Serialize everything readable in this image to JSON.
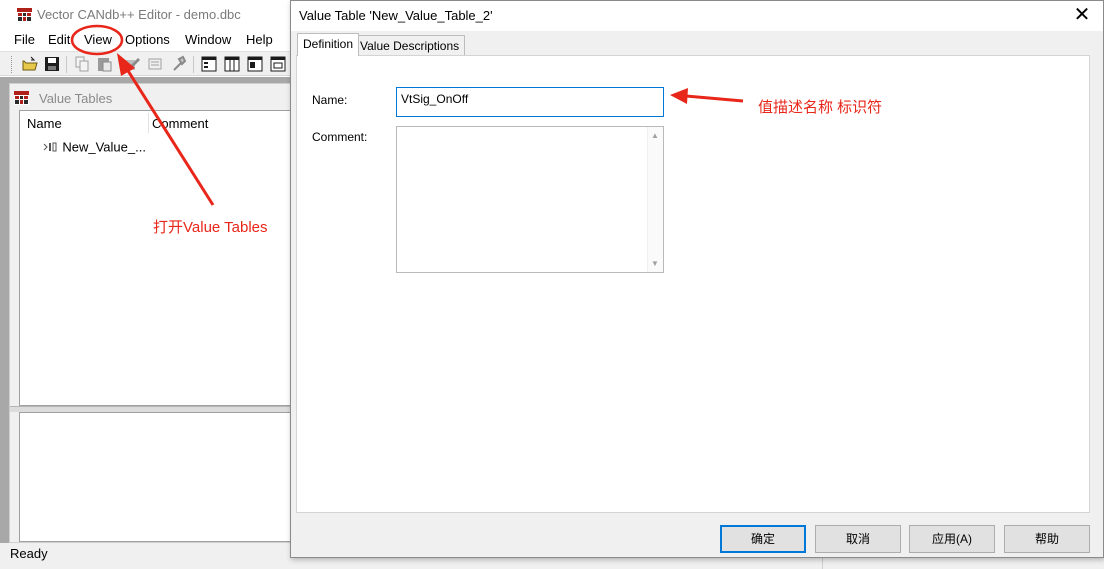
{
  "main_window": {
    "title": "Vector CANdb++ Editor - demo.dbc",
    "menu": [
      "File",
      "Edit",
      "View",
      "Options",
      "Window",
      "Help"
    ],
    "status": "Ready"
  },
  "value_tables_window": {
    "title": "Value Tables",
    "columns": [
      "Name",
      "Comment"
    ],
    "rows": [
      {
        "name": "New_Value_...",
        "comment": ""
      }
    ]
  },
  "dialog": {
    "title": "Value Table 'New_Value_Table_2'",
    "close_glyph": "✕",
    "tabs": [
      "Definition",
      "Value Descriptions"
    ],
    "active_tab": "Definition",
    "name_label": "Name:",
    "name_value": "VtSig_OnOff",
    "comment_label": "Comment:",
    "comment_value": "",
    "buttons": {
      "ok": "确定",
      "cancel": "取消",
      "apply": "应用(A)",
      "help": "帮助"
    }
  },
  "annotations": {
    "view_menu_note": "打开Value Tables",
    "name_field_note": "值描述名称 标识符",
    "color": "#e8261a"
  },
  "icons": [
    "app-icon",
    "open-folder-icon",
    "save-icon",
    "copy-icon",
    "paste-icon",
    "edit-icon",
    "properties-icon",
    "tools-icon",
    "table-view-icon",
    "list-view-icon",
    "detail-view-icon",
    "window-view-icon",
    "value-table-item-icon"
  ]
}
